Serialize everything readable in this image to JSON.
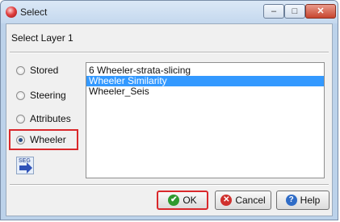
{
  "window": {
    "title": "Select",
    "minimize_glyph": "–",
    "maximize_glyph": "□",
    "close_glyph": "✕"
  },
  "dialog": {
    "heading": "Select Layer 1",
    "options": [
      {
        "label": "Stored",
        "checked": false
      },
      {
        "label": "Steering",
        "checked": false
      },
      {
        "label": "Attributes",
        "checked": false
      },
      {
        "label": "Wheeler",
        "checked": true
      }
    ],
    "icon_text": "SEG",
    "list": {
      "items": [
        "6 Wheeler-strata-slicing",
        "Wheeler Similarity",
        "Wheeler_Seis"
      ],
      "selected_index": 1
    }
  },
  "buttons": {
    "ok": "OK",
    "cancel": "Cancel",
    "help": "Help",
    "ok_icon": "✔",
    "cancel_icon": "✕",
    "help_icon": "?"
  },
  "colors": {
    "selection": "#3399ff",
    "annotation_highlight": "#d9282b",
    "title_bar": "#c4d8ee"
  }
}
